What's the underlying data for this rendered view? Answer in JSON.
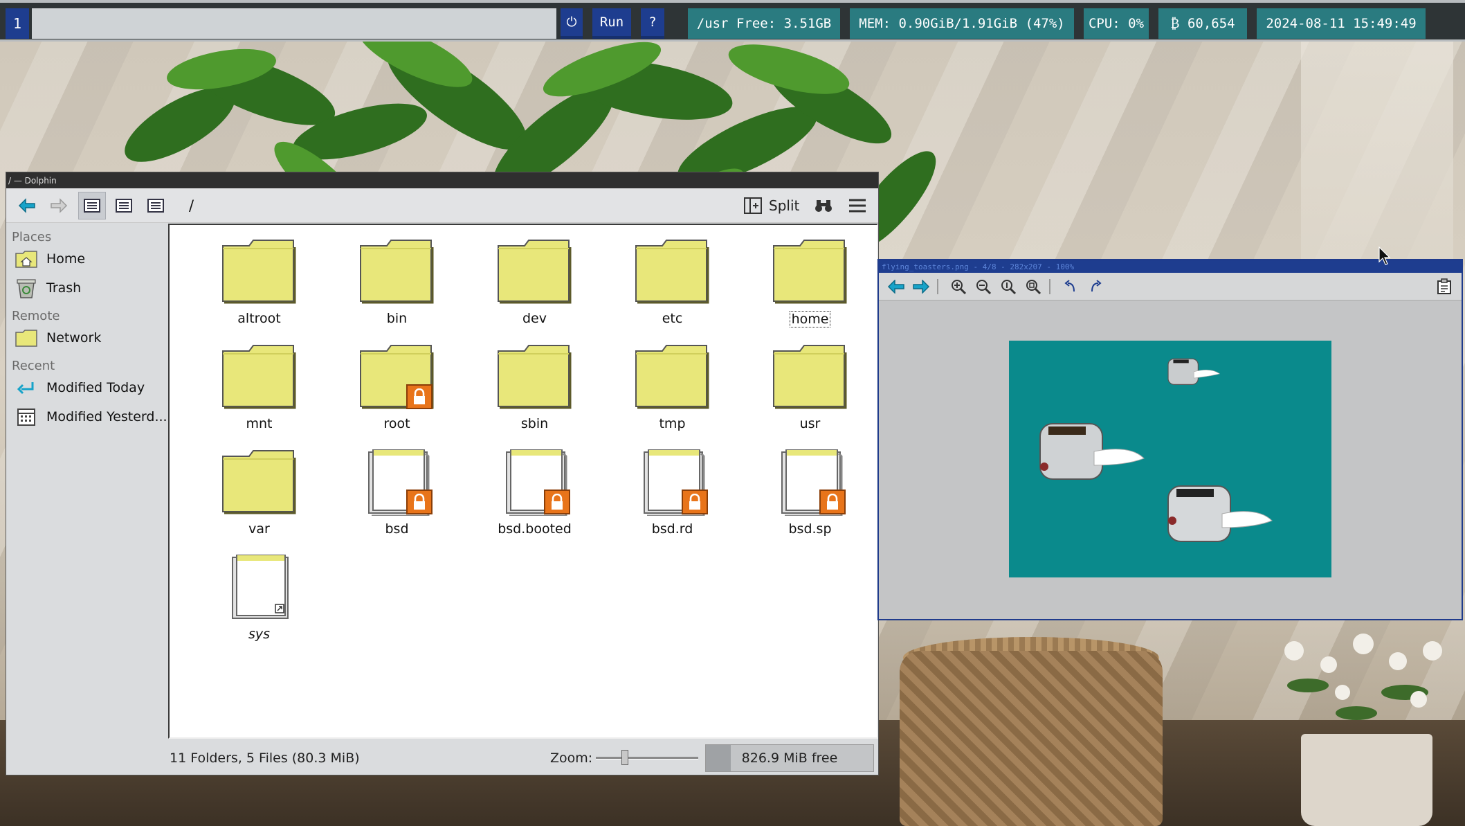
{
  "panel": {
    "workspace": "1",
    "power_icon": "power-icon",
    "run_label": "Run",
    "help_label": "?",
    "disk": "/usr Free: 3.51GB",
    "mem": "MEM: 0.90GiB/1.91GiB (47%)",
    "cpu": "CPU: 0%",
    "btc": "₿ 60,654",
    "clock": "2024-08-11 15:49:49"
  },
  "dolphin": {
    "title": "/ — Dolphin",
    "path": "/",
    "split_label": "Split",
    "sidebar": {
      "places_header": "Places",
      "places": [
        {
          "label": "Home",
          "icon": "folder-home-icon"
        },
        {
          "label": "Trash",
          "icon": "trash-icon"
        }
      ],
      "remote_header": "Remote",
      "remote": [
        {
          "label": "Network",
          "icon": "folder-network-icon"
        }
      ],
      "recent_header": "Recent",
      "recent": [
        {
          "label": "Modified Today",
          "icon": "recent-today-icon"
        },
        {
          "label": "Modified Yesterd...",
          "icon": "calendar-icon"
        }
      ]
    },
    "items": [
      {
        "name": "altroot",
        "type": "folder"
      },
      {
        "name": "bin",
        "type": "folder"
      },
      {
        "name": "dev",
        "type": "folder"
      },
      {
        "name": "etc",
        "type": "folder"
      },
      {
        "name": "home",
        "type": "folder",
        "focused": true
      },
      {
        "name": "mnt",
        "type": "folder"
      },
      {
        "name": "root",
        "type": "folder",
        "locked": true
      },
      {
        "name": "sbin",
        "type": "folder"
      },
      {
        "name": "tmp",
        "type": "folder"
      },
      {
        "name": "usr",
        "type": "folder"
      },
      {
        "name": "var",
        "type": "folder"
      },
      {
        "name": "bsd",
        "type": "file",
        "locked": true
      },
      {
        "name": "bsd.booted",
        "type": "file",
        "locked": true
      },
      {
        "name": "bsd.rd",
        "type": "file",
        "locked": true
      },
      {
        "name": "bsd.sp",
        "type": "file",
        "locked": true
      },
      {
        "name": "sys",
        "type": "link"
      }
    ],
    "status": "11 Folders, 5 Files (80.3 MiB)",
    "zoom_label": "Zoom:",
    "free_space": "826.9 MiB free",
    "free_space_used_fraction": 0.15,
    "zoom_level_fraction": 0.27
  },
  "viewer": {
    "title": "flying_toasters.png - 4/8 - 282x207 - 100%",
    "canvas_color": "#0a8a8c"
  },
  "colors": {
    "panel_blue": "#1e3d8f",
    "panel_teal": "#2a7b80",
    "folder_yellow": "#e8e77a",
    "lock_orange": "#e8741a"
  }
}
